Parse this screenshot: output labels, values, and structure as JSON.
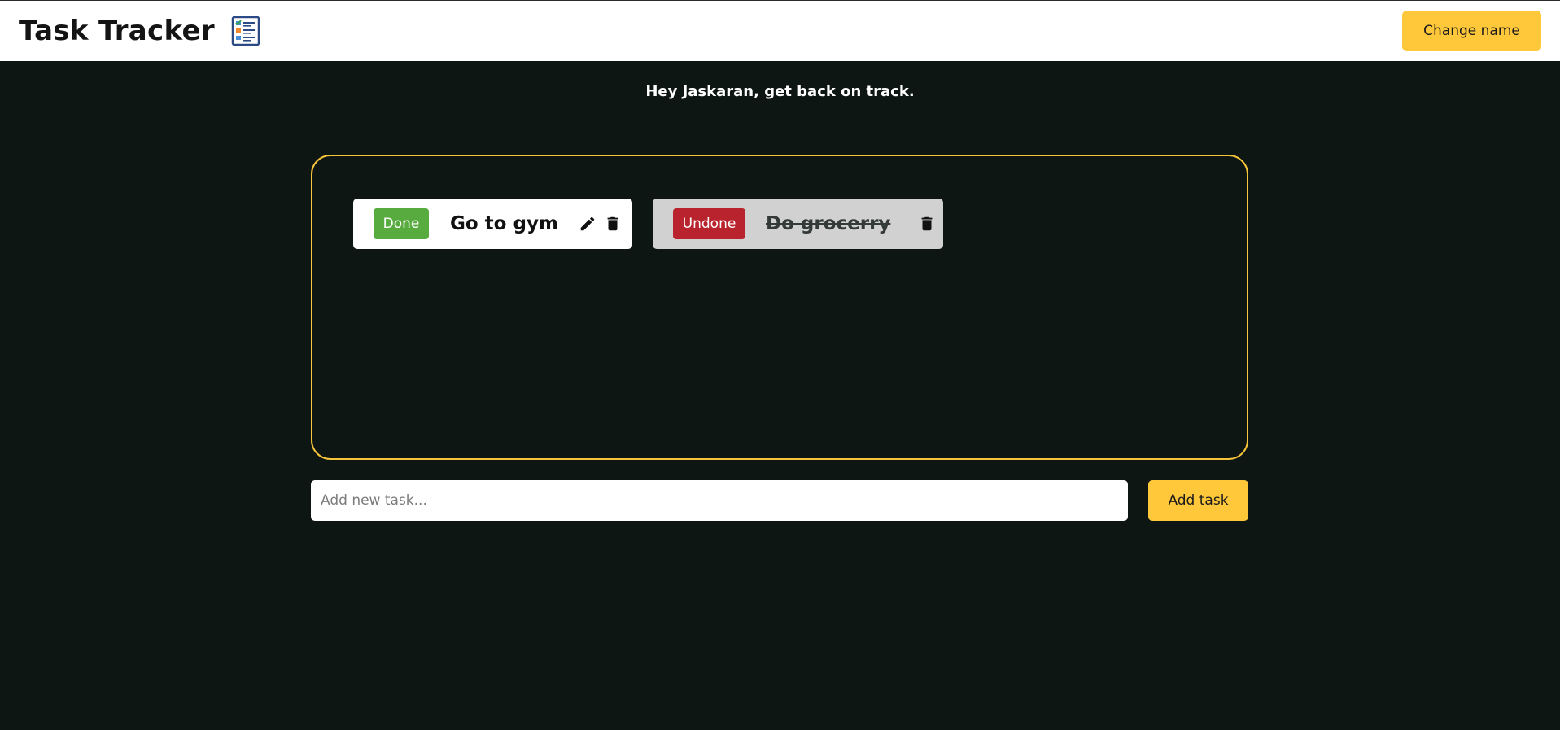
{
  "header": {
    "title": "Task Tracker",
    "logo_icon": "checklist-icon",
    "change_name_label": "Change name"
  },
  "greeting": "Hey Jaskaran, get back on track.",
  "tasks": [
    {
      "name": "Go to gym",
      "status_label": "Done",
      "completed": false,
      "icons": [
        "pencil-icon",
        "trash-icon"
      ]
    },
    {
      "name": "Do grocerry",
      "status_label": "Undone",
      "completed": true,
      "icons": [
        "trash-icon"
      ]
    }
  ],
  "new_task": {
    "placeholder": "Add new task...",
    "value": "",
    "add_label": "Add task"
  },
  "colors": {
    "accent": "#ffc83a",
    "background": "#0e1614",
    "done": "#58ab3e",
    "undone": "#b9232e",
    "board_border": "#f5c43a"
  }
}
